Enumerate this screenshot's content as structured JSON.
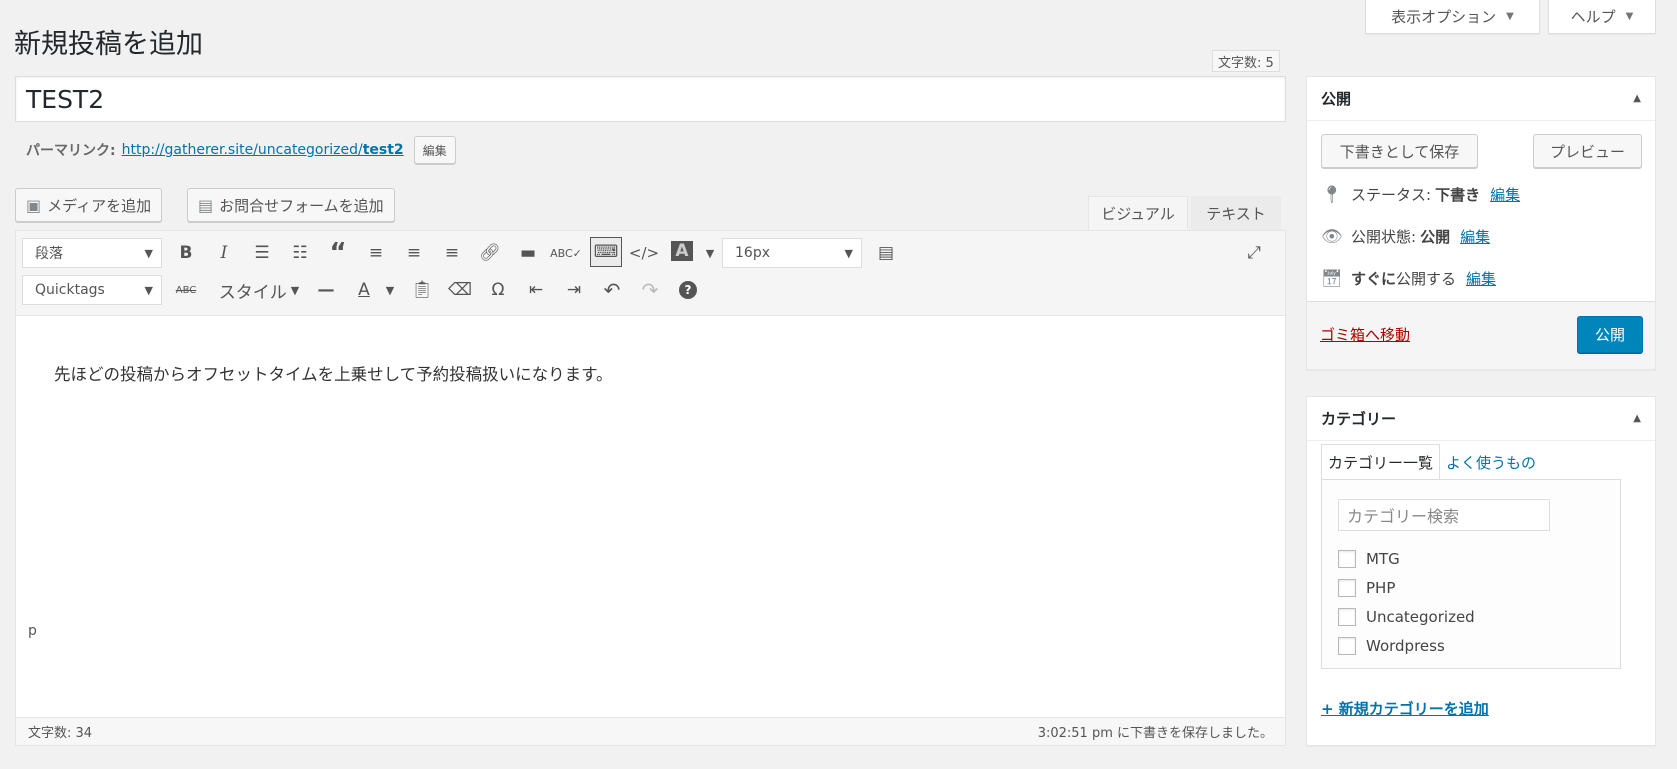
{
  "screen_options": {
    "display_options": "表示オプション",
    "help": "ヘルプ"
  },
  "page_title": "新規投稿を追加",
  "title_wordcount": "文字数: 5",
  "post_title": "TEST2",
  "permalink": {
    "label": "パーマリンク:",
    "url_base": "http://gatherer.site/uncategorized/",
    "slug": "test2",
    "edit": "編集"
  },
  "media": {
    "add_media": "メディアを追加",
    "add_form": "お問合せフォームを追加"
  },
  "editor_tabs": {
    "visual": "ビジュアル",
    "text": "テキスト"
  },
  "toolbar": {
    "format_select": "段落",
    "font_size": "16px",
    "quicktags": "Quicktags",
    "style_label": "スタイル",
    "icons_row1": [
      "bold-icon",
      "italic-icon",
      "bullet-list-icon",
      "numbered-list-icon",
      "blockquote-icon",
      "align-left-icon",
      "align-center-icon",
      "align-right-icon",
      "link-icon",
      "read-more-icon",
      "spellcheck-icon",
      "keyboard-icon",
      "code-icon",
      "text-color-icon",
      "table-icon",
      "fullscreen-icon"
    ],
    "icons_row2": [
      "strikethrough-icon",
      "horizontal-line-icon",
      "text-color-icon",
      "paste-text-icon",
      "clear-format-icon",
      "special-char-icon",
      "outdent-icon",
      "indent-icon",
      "undo-icon",
      "redo-icon",
      "help-icon"
    ]
  },
  "content": "先ほどの投稿からオフセットタイムを上乗せして予約投稿扱いになります。",
  "status": {
    "path": "p",
    "wordcount": "文字数: 34",
    "autosave": "3:02:51 pm に下書きを保存しました。"
  },
  "publish_box": {
    "title": "公開",
    "save_draft": "下書きとして保存",
    "preview": "プレビュー",
    "status_label": "ステータス:",
    "status_value": "下書き",
    "visibility_label": "公開状態:",
    "visibility_value": "公開",
    "schedule_bold": "すぐに",
    "schedule_rest": "公開する",
    "edit": "編集",
    "trash": "ゴミ箱へ移動",
    "publish": "公開"
  },
  "category_box": {
    "title": "カテゴリー",
    "tab_all": "カテゴリー一覧",
    "tab_popular": "よく使うもの",
    "search_placeholder": "カテゴリー検索",
    "items": [
      "MTG",
      "PHP",
      "Uncategorized",
      "Wordpress"
    ],
    "add_new": "+ 新規カテゴリーを追加"
  }
}
